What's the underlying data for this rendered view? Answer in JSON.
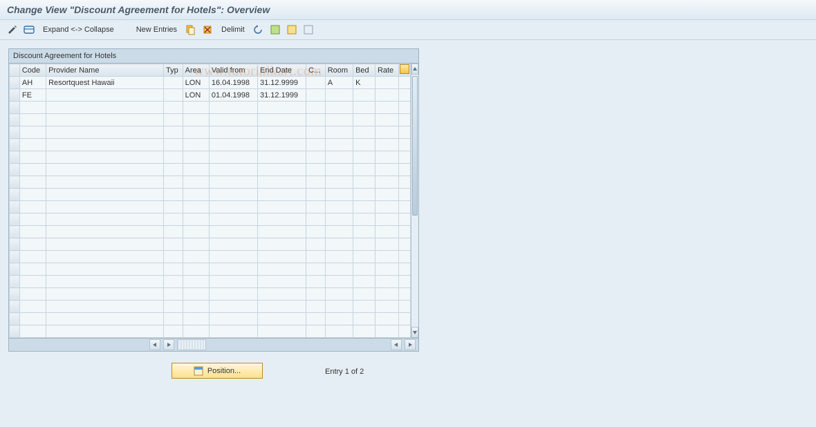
{
  "title": "Change View \"Discount Agreement for Hotels\": Overview",
  "toolbar": {
    "expand_collapse": "Expand <-> Collapse",
    "new_entries": "New Entries",
    "delimit": "Delimit"
  },
  "panel": {
    "title": "Discount Agreement for Hotels",
    "columns": {
      "code": "Code",
      "provider": "Provider Name",
      "typ": "Typ",
      "area": "Area",
      "valid_from": "Valid from",
      "end_date": "End Date",
      "c": "C...",
      "room": "Room",
      "bed": "Bed",
      "rate": "Rate"
    },
    "rows": [
      {
        "code": "AH",
        "provider": "Resortquest Hawaii",
        "typ": "",
        "area": "LON",
        "valid_from": "16.04.1998",
        "end_date": "31.12.9999",
        "c": "",
        "room": "A",
        "bed": "K",
        "rate": ""
      },
      {
        "code": "FE",
        "provider": "",
        "typ": "",
        "area": "LON",
        "valid_from": "01.04.1998",
        "end_date": "31.12.1999",
        "c": "",
        "room": "",
        "bed": "",
        "rate": ""
      }
    ],
    "empty_rows": 19
  },
  "footer": {
    "position_label": "Position...",
    "entry_text": "Entry 1 of 2"
  },
  "watermark": "www.tutorialkart.com"
}
